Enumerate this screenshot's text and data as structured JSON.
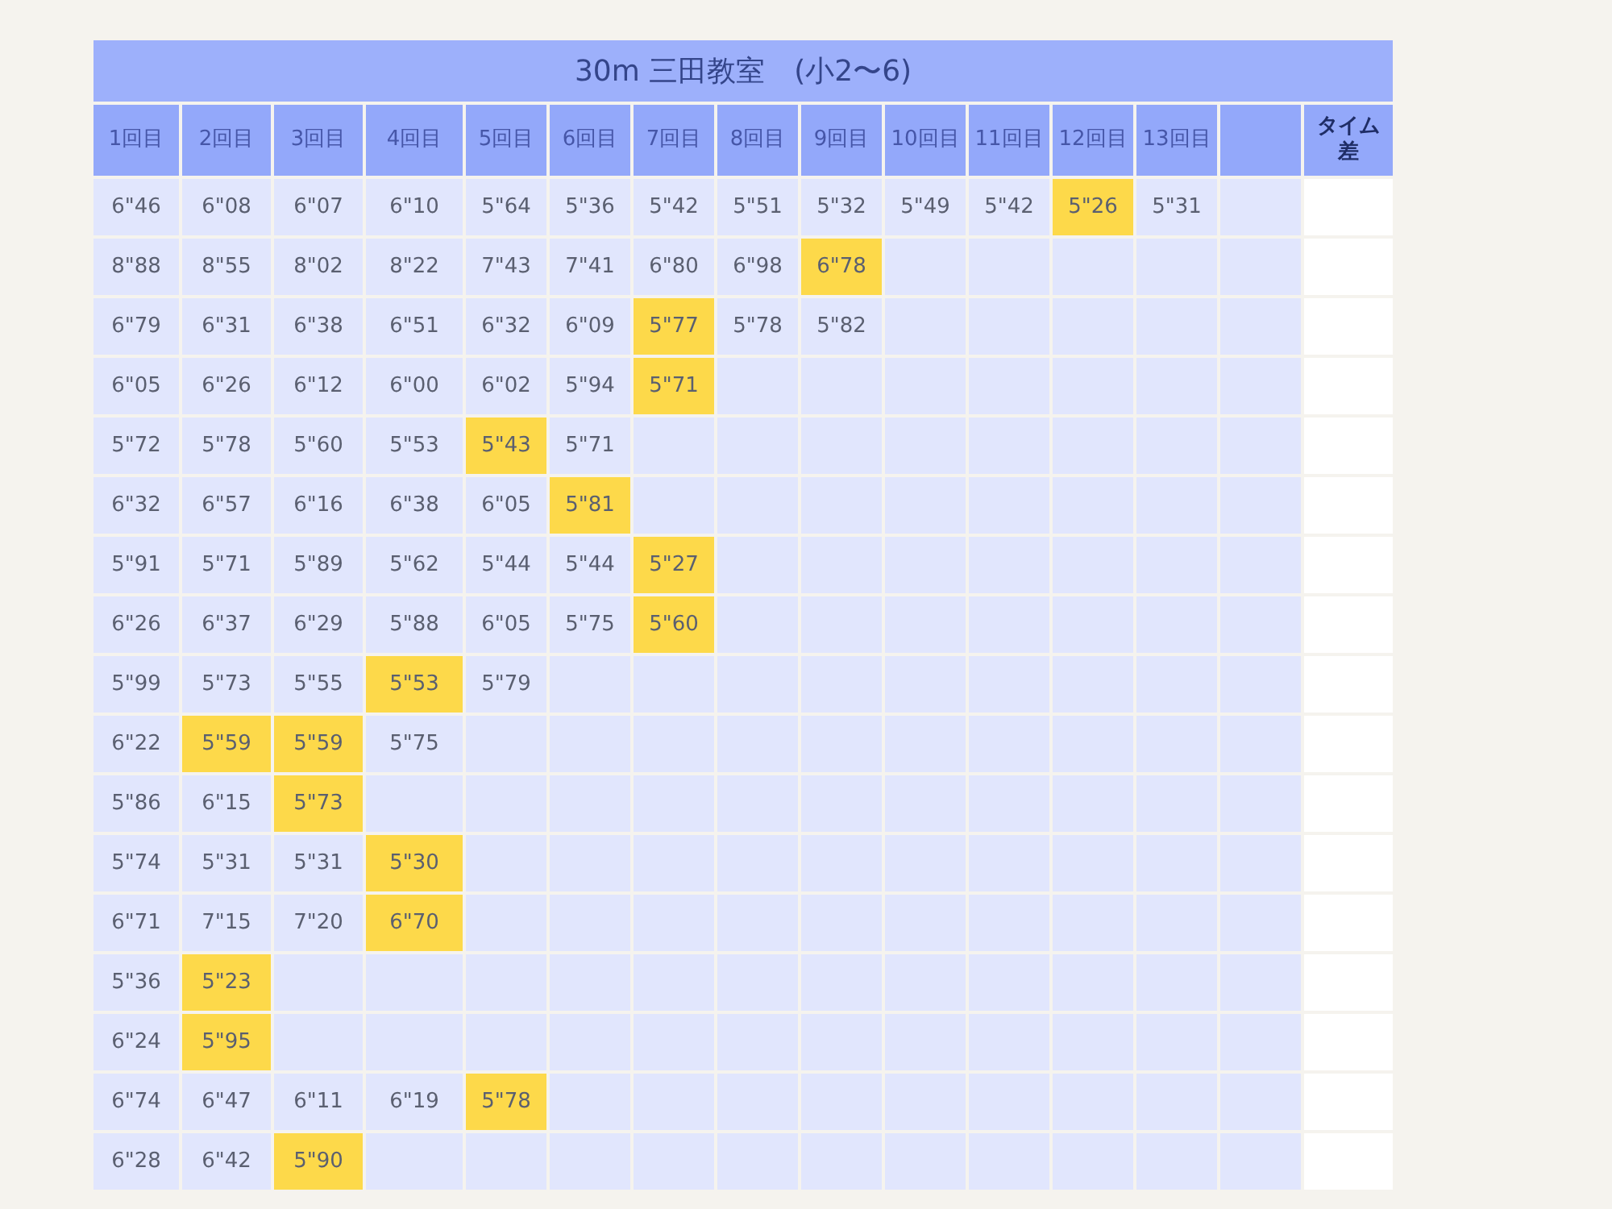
{
  "title": "30m 三田教室　(小2〜6)",
  "columns": [
    {
      "kind": "round",
      "label": "1回目"
    },
    {
      "kind": "round",
      "label": "2回目"
    },
    {
      "kind": "round",
      "label": "3回目"
    },
    {
      "kind": "round",
      "label": "4回目"
    },
    {
      "kind": "round",
      "label": "5回目"
    },
    {
      "kind": "round",
      "label": "6回目"
    },
    {
      "kind": "round",
      "label": "7回目"
    },
    {
      "kind": "round",
      "label": "8回目"
    },
    {
      "kind": "round",
      "label": "9回目"
    },
    {
      "kind": "round",
      "label": "10回目"
    },
    {
      "kind": "round",
      "label": "11回目"
    },
    {
      "kind": "round",
      "label": "12回目"
    },
    {
      "kind": "round",
      "label": "13回目"
    },
    {
      "kind": "blank"
    },
    {
      "kind": "diff",
      "label": "タイム差"
    }
  ],
  "rows": [
    [
      {
        "value": "6\"46",
        "highlighted": false
      },
      {
        "value": "6\"08",
        "highlighted": false
      },
      {
        "value": "6\"07",
        "highlighted": false
      },
      {
        "value": "6\"10",
        "highlighted": false
      },
      {
        "value": "5\"64",
        "highlighted": false
      },
      {
        "value": "5\"36",
        "highlighted": false
      },
      {
        "value": "5\"42",
        "highlighted": false
      },
      {
        "value": "5\"51",
        "highlighted": false
      },
      {
        "value": "5\"32",
        "highlighted": false
      },
      {
        "value": "5\"49",
        "highlighted": false
      },
      {
        "value": "5\"42",
        "highlighted": false
      },
      {
        "value": "5\"26",
        "highlighted": true
      },
      {
        "value": "5\"31",
        "highlighted": false
      }
    ],
    [
      {
        "value": "8\"88",
        "highlighted": false
      },
      {
        "value": "8\"55",
        "highlighted": false
      },
      {
        "value": "8\"02",
        "highlighted": false
      },
      {
        "value": "8\"22",
        "highlighted": false
      },
      {
        "value": "7\"43",
        "highlighted": false
      },
      {
        "value": "7\"41",
        "highlighted": false
      },
      {
        "value": "6\"80",
        "highlighted": false
      },
      {
        "value": "6\"98",
        "highlighted": false
      },
      {
        "value": "6\"78",
        "highlighted": true
      }
    ],
    [
      {
        "value": "6\"79",
        "highlighted": false
      },
      {
        "value": "6\"31",
        "highlighted": false
      },
      {
        "value": "6\"38",
        "highlighted": false
      },
      {
        "value": "6\"51",
        "highlighted": false
      },
      {
        "value": "6\"32",
        "highlighted": false
      },
      {
        "value": "6\"09",
        "highlighted": false
      },
      {
        "value": "5\"77",
        "highlighted": true
      },
      {
        "value": "5\"78",
        "highlighted": false
      },
      {
        "value": "5\"82",
        "highlighted": false
      }
    ],
    [
      {
        "value": "6\"05",
        "highlighted": false
      },
      {
        "value": "6\"26",
        "highlighted": false
      },
      {
        "value": "6\"12",
        "highlighted": false
      },
      {
        "value": "6\"00",
        "highlighted": false
      },
      {
        "value": "6\"02",
        "highlighted": false
      },
      {
        "value": "5\"94",
        "highlighted": false
      },
      {
        "value": "5\"71",
        "highlighted": true
      }
    ],
    [
      {
        "value": "5\"72",
        "highlighted": false
      },
      {
        "value": "5\"78",
        "highlighted": false
      },
      {
        "value": "5\"60",
        "highlighted": false
      },
      {
        "value": "5\"53",
        "highlighted": false
      },
      {
        "value": "5\"43",
        "highlighted": true
      },
      {
        "value": "5\"71",
        "highlighted": false
      }
    ],
    [
      {
        "value": "6\"32",
        "highlighted": false
      },
      {
        "value": "6\"57",
        "highlighted": false
      },
      {
        "value": "6\"16",
        "highlighted": false
      },
      {
        "value": "6\"38",
        "highlighted": false
      },
      {
        "value": "6\"05",
        "highlighted": false
      },
      {
        "value": "5\"81",
        "highlighted": true
      }
    ],
    [
      {
        "value": "5\"91",
        "highlighted": false
      },
      {
        "value": "5\"71",
        "highlighted": false
      },
      {
        "value": "5\"89",
        "highlighted": false
      },
      {
        "value": "5\"62",
        "highlighted": false
      },
      {
        "value": "5\"44",
        "highlighted": false
      },
      {
        "value": "5\"44",
        "highlighted": false
      },
      {
        "value": "5\"27",
        "highlighted": true
      }
    ],
    [
      {
        "value": "6\"26",
        "highlighted": false
      },
      {
        "value": "6\"37",
        "highlighted": false
      },
      {
        "value": "6\"29",
        "highlighted": false
      },
      {
        "value": "5\"88",
        "highlighted": false
      },
      {
        "value": "6\"05",
        "highlighted": false
      },
      {
        "value": "5\"75",
        "highlighted": false
      },
      {
        "value": "5\"60",
        "highlighted": true
      }
    ],
    [
      {
        "value": "5\"99",
        "highlighted": false
      },
      {
        "value": "5\"73",
        "highlighted": false
      },
      {
        "value": "5\"55",
        "highlighted": false
      },
      {
        "value": "5\"53",
        "highlighted": true
      },
      {
        "value": "5\"79",
        "highlighted": false
      }
    ],
    [
      {
        "value": "6\"22",
        "highlighted": false
      },
      {
        "value": "5\"59",
        "highlighted": true
      },
      {
        "value": "5\"59",
        "highlighted": true
      },
      {
        "value": "5\"75",
        "highlighted": false
      }
    ],
    [
      {
        "value": "5\"86",
        "highlighted": false
      },
      {
        "value": "6\"15",
        "highlighted": false
      },
      {
        "value": "5\"73",
        "highlighted": true
      }
    ],
    [
      {
        "value": "5\"74",
        "highlighted": false
      },
      {
        "value": "5\"31",
        "highlighted": false
      },
      {
        "value": "5\"31",
        "highlighted": false
      },
      {
        "value": "5\"30",
        "highlighted": true
      }
    ],
    [
      {
        "value": "6\"71",
        "highlighted": false
      },
      {
        "value": "7\"15",
        "highlighted": false
      },
      {
        "value": "7\"20",
        "highlighted": false
      },
      {
        "value": "6\"70",
        "highlighted": true
      }
    ],
    [
      {
        "value": "5\"36",
        "highlighted": false
      },
      {
        "value": "5\"23",
        "highlighted": true
      }
    ],
    [
      {
        "value": "6\"24",
        "highlighted": false
      },
      {
        "value": "5\"95",
        "highlighted": true
      }
    ],
    [
      {
        "value": "6\"74",
        "highlighted": false
      },
      {
        "value": "6\"47",
        "highlighted": false
      },
      {
        "value": "6\"11",
        "highlighted": false
      },
      {
        "value": "6\"19",
        "highlighted": false
      },
      {
        "value": "5\"78",
        "highlighted": true
      }
    ],
    [
      {
        "value": "6\"28",
        "highlighted": false
      },
      {
        "value": "6\"42",
        "highlighted": false
      },
      {
        "value": "5\"90",
        "highlighted": true
      }
    ]
  ]
}
